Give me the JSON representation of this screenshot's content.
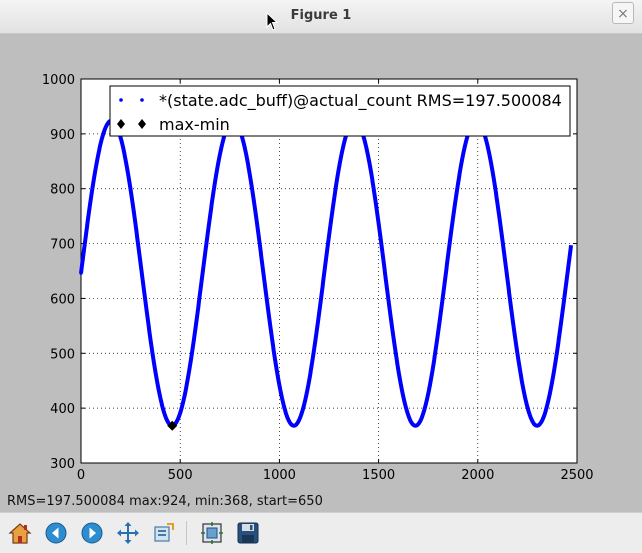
{
  "window": {
    "title": "Figure 1",
    "close_glyph": "×"
  },
  "status_text": "RMS=197.500084 max:924, min:368, start=650",
  "toolbar": {
    "buttons": [
      {
        "name": "home-button",
        "icon": "home-icon"
      },
      {
        "name": "back-button",
        "icon": "back-arrow-icon"
      },
      {
        "name": "forward-button",
        "icon": "forward-arrow-icon"
      },
      {
        "name": "pan-button",
        "icon": "move-icon"
      },
      {
        "name": "zoom-button",
        "icon": "zoom-rect-icon"
      },
      {
        "name": "subplots-button",
        "icon": "subplots-icon"
      },
      {
        "name": "save-button",
        "icon": "save-icon"
      }
    ]
  },
  "colors": {
    "series": "#0000ff",
    "marker": "#000000",
    "plot_bg": "#ffffff",
    "figure_bg": "#bebebe"
  },
  "chart_data": {
    "type": "scatter",
    "xlim": [
      0,
      2500
    ],
    "ylim": [
      300,
      1000
    ],
    "xticks": [
      0,
      500,
      1000,
      1500,
      2000,
      2500
    ],
    "yticks": [
      300,
      400,
      500,
      600,
      700,
      800,
      900,
      1000
    ],
    "grid": true,
    "legend_position": "top-right",
    "series": [
      {
        "name": "*(state.adc_buff)@actual_count RMS=197.500084",
        "marker": "dot",
        "color": "#0000ff",
        "model": "sine",
        "x_range": [
          0,
          2470
        ],
        "mean": 646,
        "amplitude": 278,
        "period": 613,
        "phase_x": 0
      },
      {
        "name": "max-min",
        "marker": "diamond",
        "color": "#000000",
        "points": [
          [
            2000,
            924
          ],
          [
            460,
            368
          ]
        ]
      }
    ]
  }
}
